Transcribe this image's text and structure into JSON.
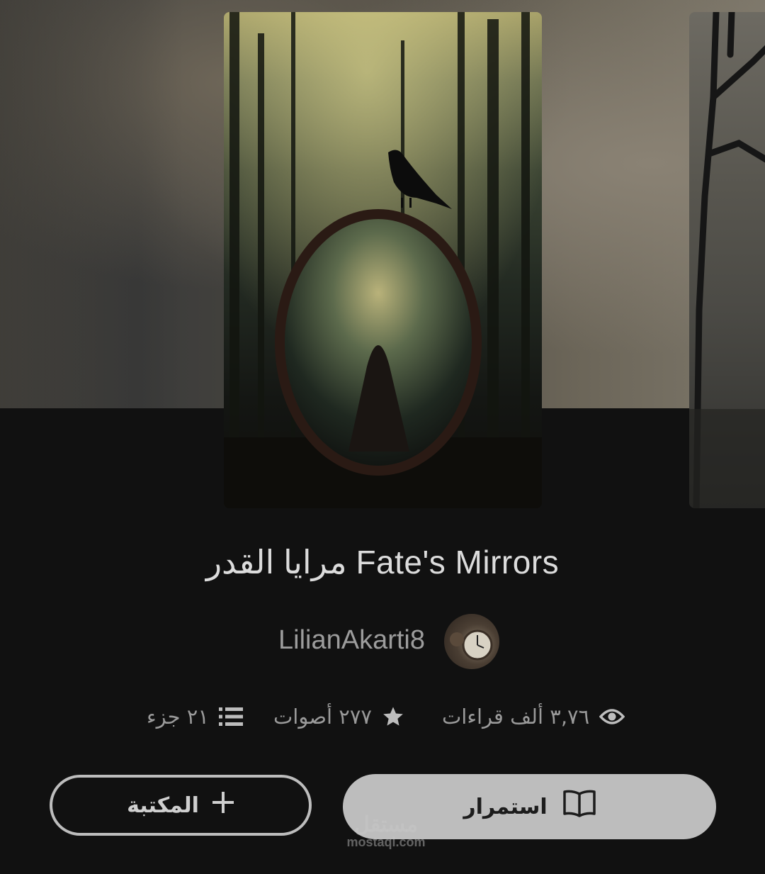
{
  "story": {
    "title": "مرايا القدر Fate's Mirrors",
    "author": "LilianAkarti8"
  },
  "stats": {
    "reads": "٣,٧٦ ألف قراءات",
    "votes": "٢٧٧ أصوات",
    "parts": "٢١ جزء"
  },
  "icons": {
    "reads": "eye-icon",
    "votes": "star-icon",
    "parts": "list-icon",
    "continue": "book-open-icon",
    "library": "plus-icon"
  },
  "buttons": {
    "continue_label": "استمرار",
    "library_label": "المكتبة"
  },
  "watermark": {
    "logo": "مستقل",
    "url": "mostaql.com"
  },
  "colors": {
    "background": "#111111",
    "primary_button": "#bdbdbd",
    "title_text": "#dcdcdc",
    "muted_text": "#9a9a9a"
  }
}
